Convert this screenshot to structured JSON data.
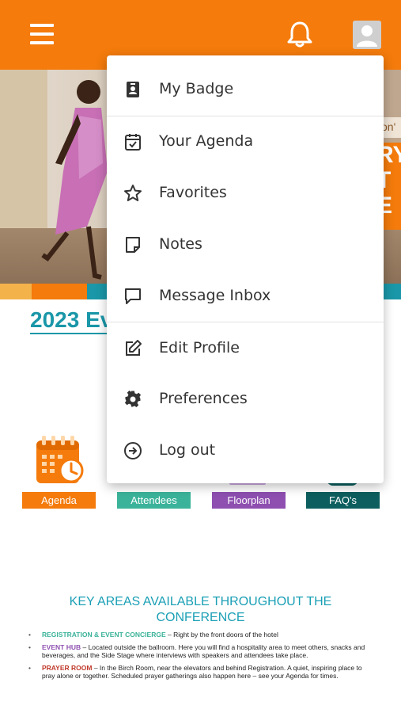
{
  "header": {
    "menu_icon": "hamburger-icon",
    "notification_icon": "bell-icon",
    "profile_icon": "user-avatar-icon",
    "background_color": "#f47b0c"
  },
  "hero": {
    "banner_partial_text": "RY\nT\nE",
    "pill_partial_text": "on'"
  },
  "event_title": "2023 Ev",
  "quick_links": [
    {
      "label": "Agenda",
      "color": "#f47b0c",
      "icon": "calendar-clock-icon"
    },
    {
      "label": "Attendees",
      "color": "#3bb39a"
    },
    {
      "label": "Floorplan",
      "color": "#8e4fb0"
    },
    {
      "label": "FAQ's",
      "color": "#0d5e5e"
    }
  ],
  "key_areas": {
    "title": "KEY AREAS AVAILABLE THROUGHOUT THE CONFERENCE",
    "items": [
      {
        "label": "REGISTRATION & EVENT CONCIERGE",
        "label_color": "#3bb39a",
        "text": " – Right by the front doors of the hotel"
      },
      {
        "label": "EVENT HUB",
        "label_color": "#8e4fb0",
        "text": " – Located outside the ballroom. Here you will find a hospitality area to meet others, snacks and beverages, and the Side Stage where interviews with speakers and attendees take place."
      },
      {
        "label": "PRAYER ROOM",
        "label_color": "#c0392b",
        "text": " – In the Birch Room, near the elevators and behind Registration. A quiet, inspiring place to pray alone or together. Scheduled prayer gatherings also happen here – see your Agenda for times."
      }
    ]
  },
  "menu": {
    "items": [
      {
        "label": "My Badge",
        "icon": "badge-icon"
      },
      {
        "label": "Your Agenda",
        "icon": "calendar-check-icon"
      },
      {
        "label": "Favorites",
        "icon": "star-icon"
      },
      {
        "label": "Notes",
        "icon": "note-icon"
      },
      {
        "label": "Message Inbox",
        "icon": "message-icon"
      },
      {
        "label": "Edit Profile",
        "icon": "edit-icon"
      },
      {
        "label": "Preferences",
        "icon": "gear-icon"
      },
      {
        "label": "Log out",
        "icon": "logout-icon"
      }
    ]
  }
}
